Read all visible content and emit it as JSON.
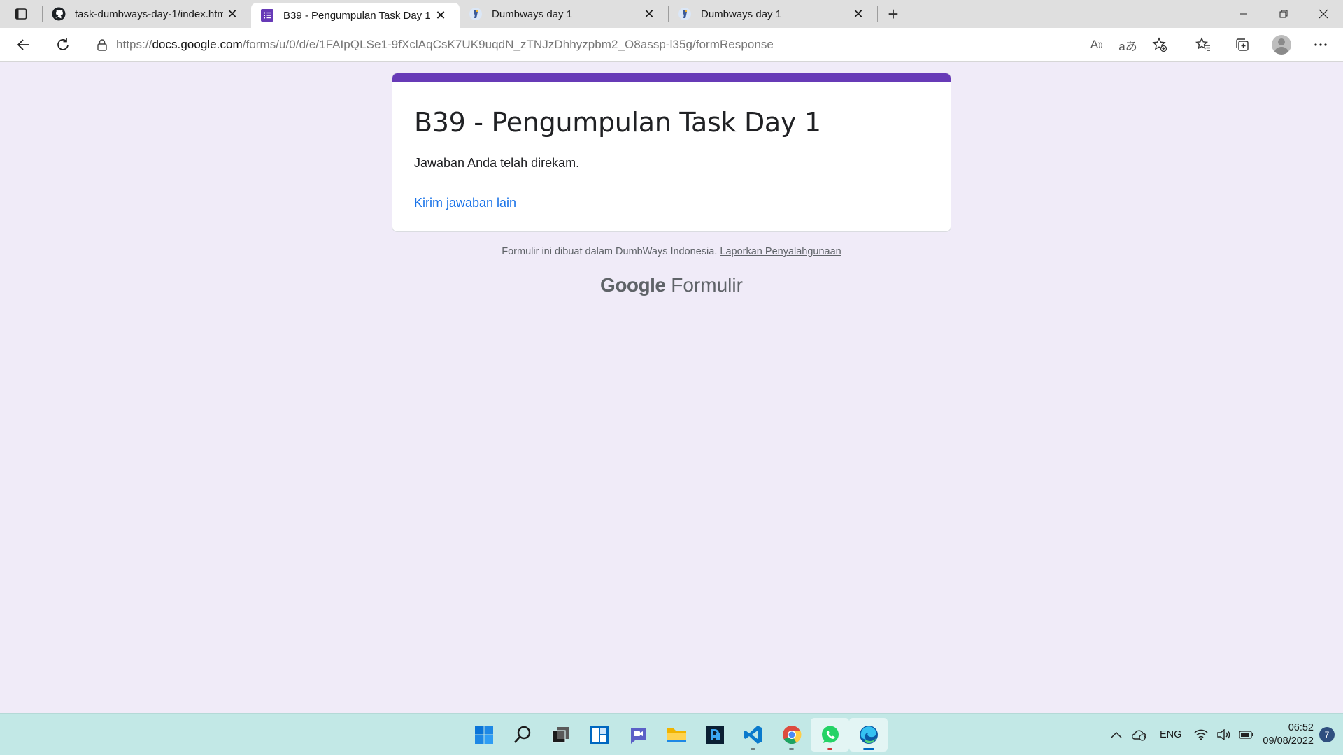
{
  "browser": {
    "tabs": [
      {
        "title": "task-dumbways-day-1/index.htm",
        "icon": "github-icon",
        "active": false
      },
      {
        "title": "B39 - Pengumpulan Task Day 1",
        "icon": "google-forms-icon",
        "active": true
      },
      {
        "title": "Dumbways day 1",
        "icon": "dumbways-icon",
        "active": false
      },
      {
        "title": "Dumbways day 1",
        "icon": "dumbways-icon",
        "active": false
      }
    ],
    "url_prefix": "https://",
    "url_host": "docs.google.com",
    "url_path": "/forms/u/0/d/e/1FAIpQLSe1-9fXclAqCsK7UK9uqdN_zTNJzDhhyzpbm2_O8assp-l35g/formResponse"
  },
  "form": {
    "title": "B39 - Pengumpulan Task Day 1",
    "confirmation": "Jawaban Anda telah direkam.",
    "resubmit_link": "Kirim jawaban lain",
    "accent_color": "#673ab7",
    "background_color": "#f0ebf8"
  },
  "footer": {
    "note": "Formulir ini dibuat dalam DumbWays Indonesia.",
    "report_link": "Laporkan Penyalahgunaan",
    "brand_google": "Google",
    "brand_product": "Formulir"
  },
  "taskbar": {
    "apps": [
      "windows-start-icon",
      "search-icon",
      "task-view-icon",
      "widgets-icon",
      "teams-chat-icon",
      "file-explorer-icon",
      "app-icon",
      "vscode-icon",
      "chrome-icon",
      "whatsapp-icon",
      "edge-icon"
    ],
    "language": "ENG",
    "time": "06:52",
    "date": "09/08/2022",
    "notifications": "7"
  }
}
